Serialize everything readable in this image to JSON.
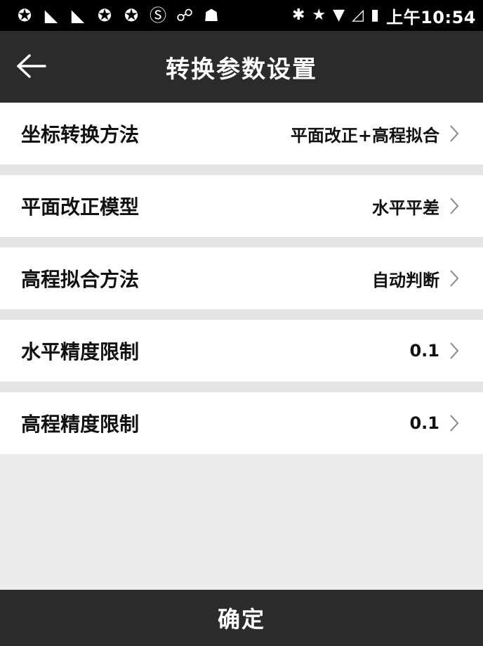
{
  "status_bar": {
    "icons": [
      "sync-icon",
      "signal-mute-icon",
      "signal-mute-icon",
      "sync-icon",
      "sync-icon",
      "s-app-icon",
      "incognito-icon",
      "android-icon",
      "bluetooth-icon",
      "star-icon",
      "wifi-icon",
      "cell-signal-icon",
      "battery-icon"
    ],
    "time": "上午10:54"
  },
  "header": {
    "title": "转换参数设置"
  },
  "settings": [
    {
      "label": "坐标转换方法",
      "value": "平面改正+高程拟合"
    },
    {
      "label": "平面改正模型",
      "value": "水平平差"
    },
    {
      "label": "高程拟合方法",
      "value": "自动判断"
    },
    {
      "label": "水平精度限制",
      "value": "0.1"
    },
    {
      "label": "高程精度限制",
      "value": "0.1"
    }
  ],
  "footer": {
    "confirm_label": "确定"
  }
}
